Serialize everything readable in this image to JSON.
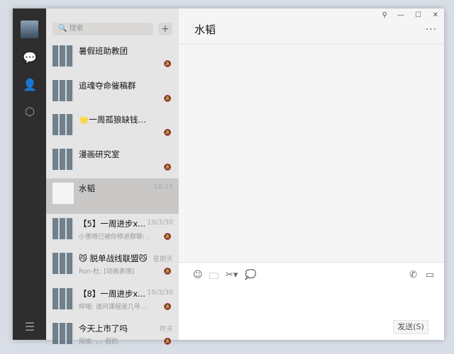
{
  "search": {
    "placeholder": "搜索"
  },
  "chat": {
    "title": "水韬",
    "send": "发送(S)"
  },
  "conversations": [
    {
      "name": "暑假班助教团",
      "time": "",
      "msg": ""
    },
    {
      "name": "追魂夺命催稿群",
      "time": "",
      "msg": ""
    },
    {
      "name": "🌟一周孤狼缺钱大队🌟",
      "time": "",
      "msg": ""
    },
    {
      "name": "漫画研究室",
      "time": "",
      "msg": ""
    },
    {
      "name": "水韬",
      "time": "10:11",
      "msg": ""
    },
    {
      "name": "【5】一周进步x...",
      "time": "19/3/30",
      "msg": "小墨晴已被你移进群聊: ..."
    },
    {
      "name": "😼 脱单战线联盟😼",
      "time": "星期天",
      "msg": "Ron-杜: [动画表情]"
    },
    {
      "name": "【8】一周进步x...",
      "time": "19/3/30",
      "msg": "梓喵: 请问课程是几号..."
    },
    {
      "name": "今天上市了吗",
      "time": "昨天",
      "msg": "周瑜: ，，假的"
    }
  ]
}
